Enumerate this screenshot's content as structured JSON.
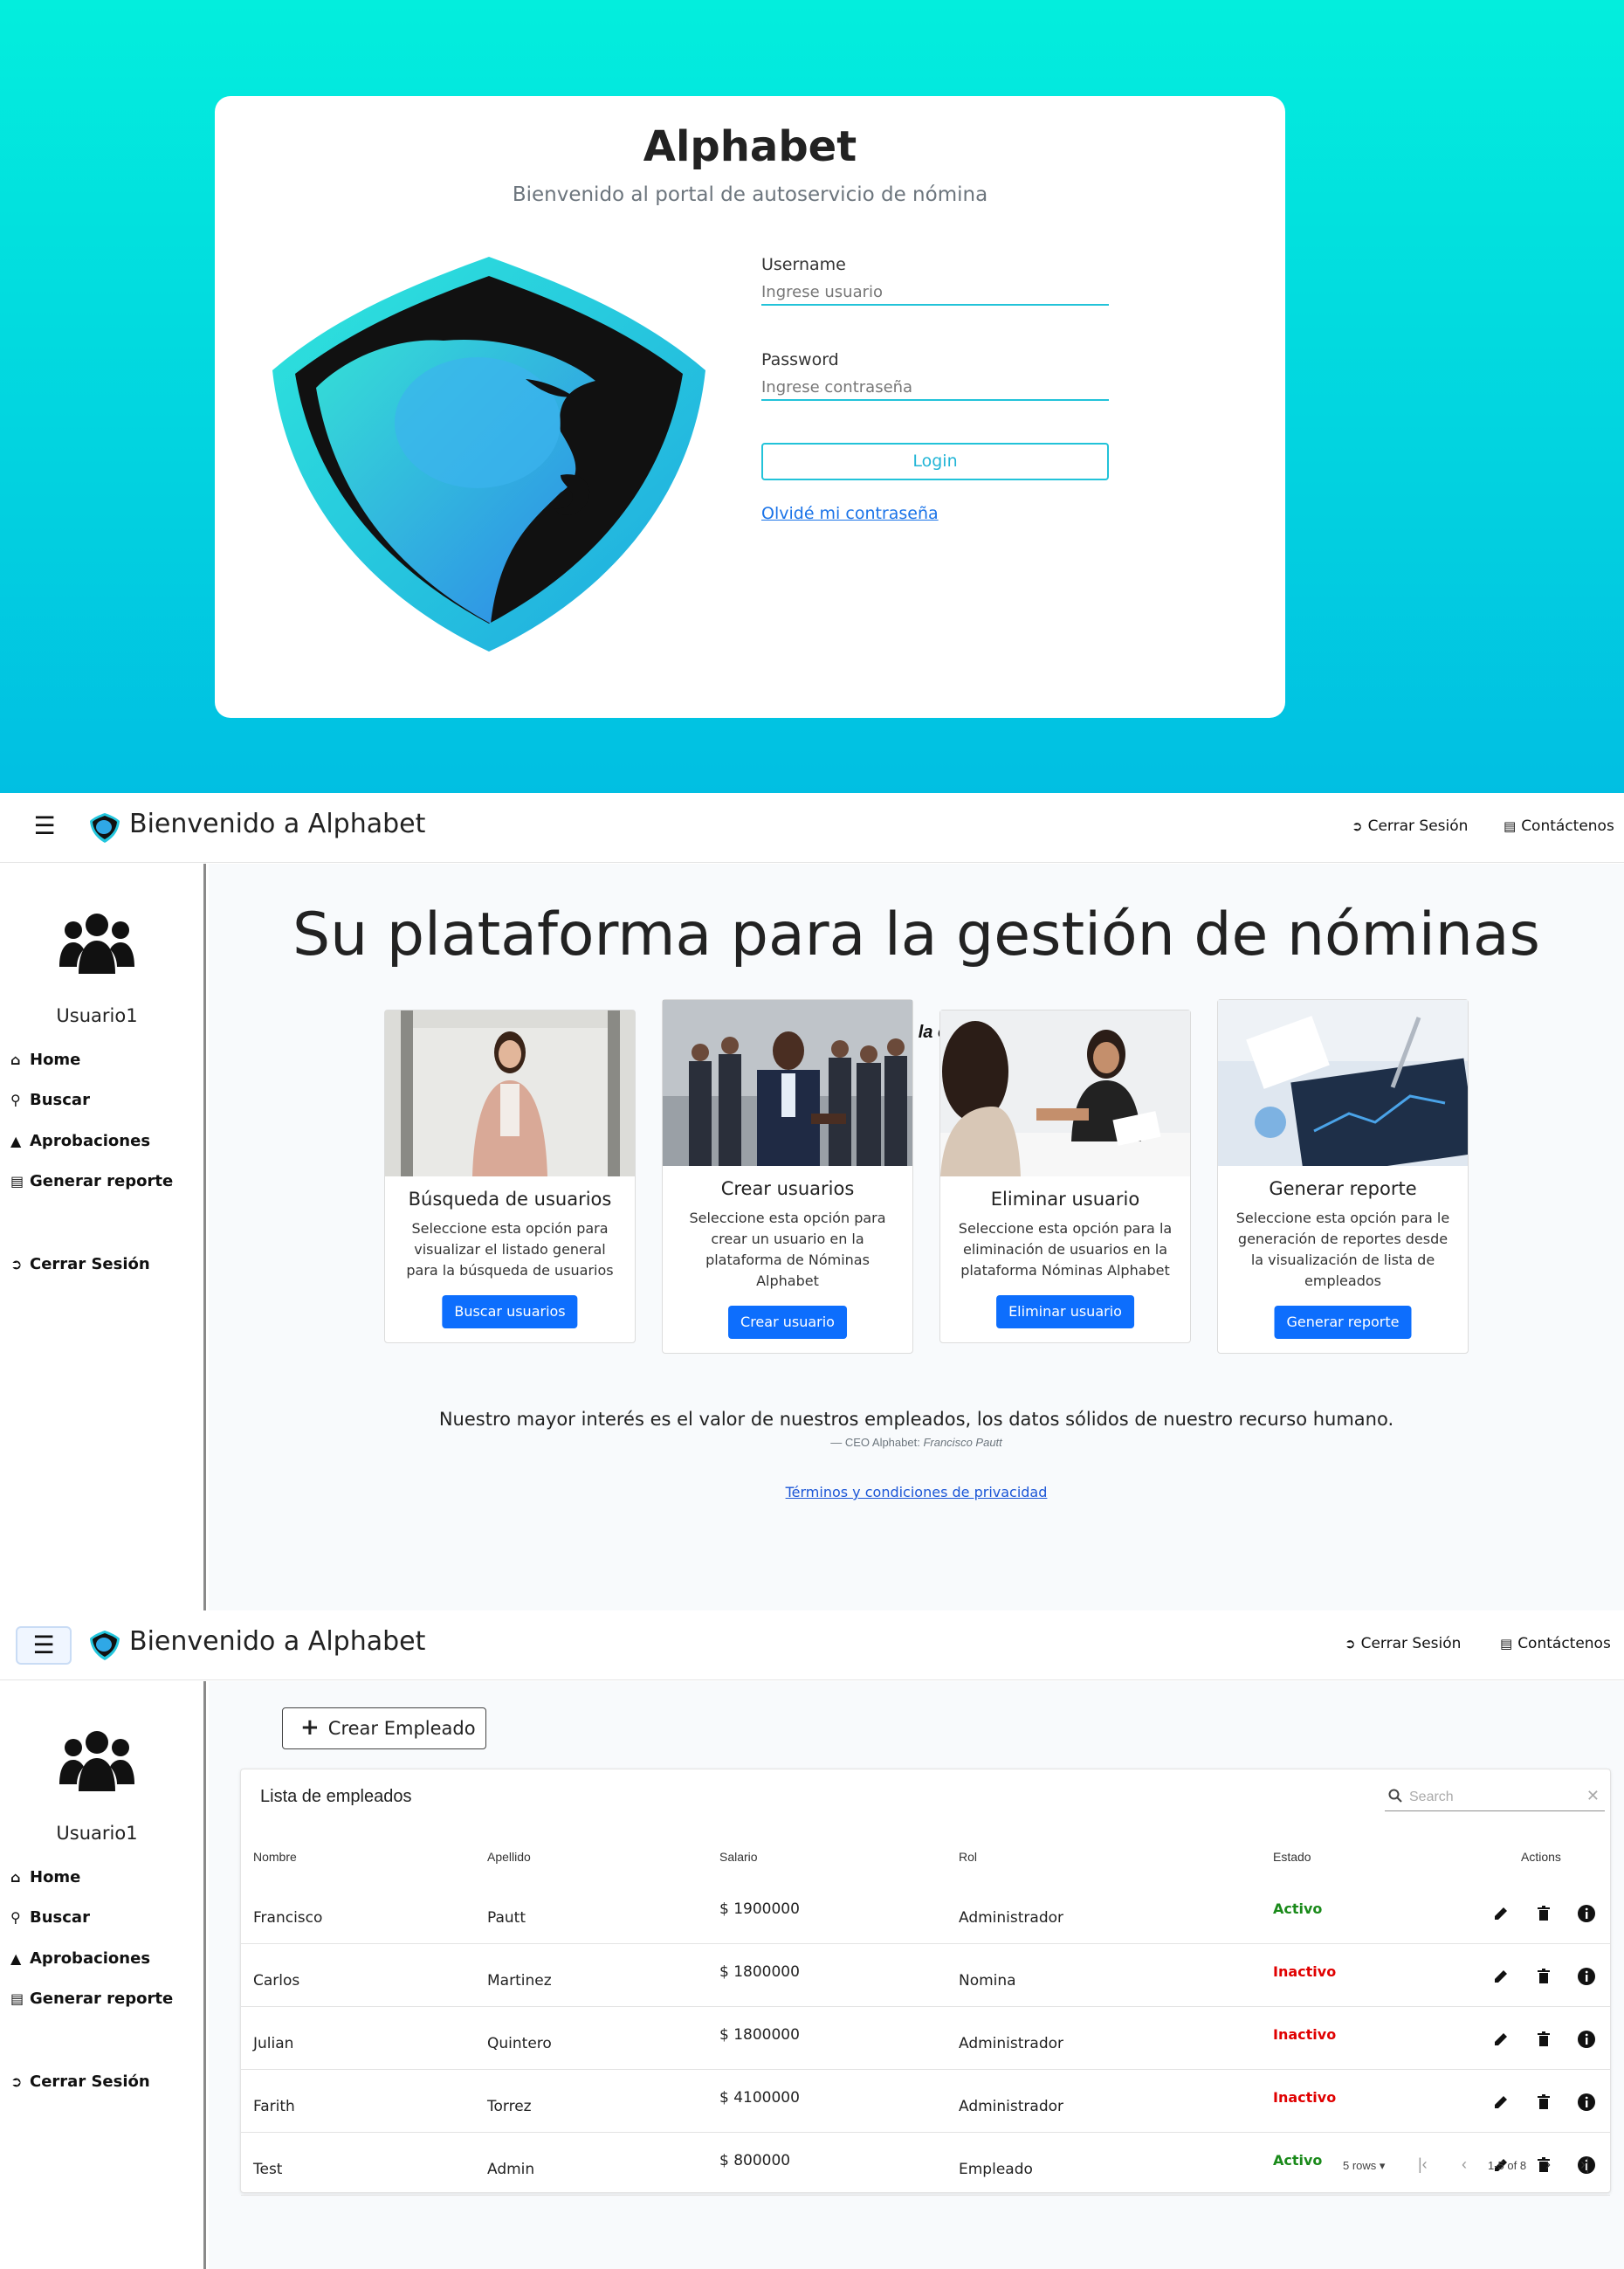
{
  "login": {
    "title": "Alphabet",
    "subtitle": "Bienvenido al portal de autoservicio de nómina",
    "username_label": "Username",
    "username_placeholder": "Ingrese usuario",
    "password_label": "Password",
    "password_placeholder": "Ingrese contraseña",
    "login_button": "Login",
    "forgot_link": "Olvidé mi contraseña",
    "colors": {
      "bg_top": "#03eedd",
      "bg_bottom": "#01bfe2",
      "accent": "#22c3d9"
    }
  },
  "navbar": {
    "brand": "Bienvenido a Alphabet",
    "logout": "Cerrar Sesión",
    "contact": "Contáctenos"
  },
  "sidebar": {
    "user": "Usuario1",
    "items": [
      {
        "label": "Home",
        "icon": "home-icon"
      },
      {
        "label": "Buscar",
        "icon": "search-icon"
      },
      {
        "label": "Aprobaciones",
        "icon": "thumbs-up-icon"
      },
      {
        "label": "Generar reporte",
        "icon": "file-icon"
      }
    ],
    "logout": "Cerrar Sesión"
  },
  "dashboard": {
    "title": "Su plataforma para la gestión de nóminas",
    "subtitle": "Seleccione la opción a la cual desea ingresar:",
    "cards": [
      {
        "title": "Búsqueda de usuarios",
        "text": "Seleccione esta opción para visualizar el listado general para la búsqueda de usuarios",
        "button": "Buscar usuarios"
      },
      {
        "title": "Crear usuarios",
        "text": "Seleccione esta opción para crear un usuario en la plataforma de Nóminas Alphabet",
        "button": "Crear usuario"
      },
      {
        "title": "Eliminar usuario",
        "text": "Seleccione esta opción para la eliminación de usuarios en la plataforma Nóminas Alphabet",
        "button": "Eliminar usuario"
      },
      {
        "title": "Generar reporte",
        "text": "Seleccione esta opción para le generación de reportes desde la visualización de lista de empleados",
        "button": "Generar reporte"
      }
    ],
    "quote": "Nuestro mayor interés es el valor de nuestros empleados, los datos sólidos de nuestro recurso humano.",
    "quote_author_prefix": "— CEO Alphabet: ",
    "quote_author": "Francisco Pautt",
    "terms": "Términos y condiciones de privacidad",
    "button_color": "#0d6efd"
  },
  "employees": {
    "create_button": "Crear Empleado",
    "table_title": "Lista de empleados",
    "search_placeholder": "Search",
    "headers": [
      "Nombre",
      "Apellido",
      "Salario",
      "Rol",
      "Estado",
      "Actions"
    ],
    "rows": [
      {
        "nombre": "Francisco",
        "apellido": "Pautt",
        "salario": "$ 1900000",
        "rol": "Administrador",
        "estado": "Activo"
      },
      {
        "nombre": "Carlos",
        "apellido": "Martinez",
        "salario": "$ 1800000",
        "rol": "Nomina",
        "estado": "Inactivo"
      },
      {
        "nombre": "Julian",
        "apellido": "Quintero",
        "salario": "$ 1800000",
        "rol": "Administrador",
        "estado": "Inactivo"
      },
      {
        "nombre": "Farith",
        "apellido": "Torrez",
        "salario": "$ 4100000",
        "rol": "Administrador",
        "estado": "Inactivo"
      },
      {
        "nombre": "Test",
        "apellido": "Admin",
        "salario": "$ 800000",
        "rol": "Empleado",
        "estado": "Activo"
      }
    ],
    "pagination": {
      "rows_per_page": "5 rows",
      "range": "1-5 of 8"
    },
    "status_colors": {
      "Activo": "#1a8a1a",
      "Inactivo": "#e00000"
    }
  }
}
